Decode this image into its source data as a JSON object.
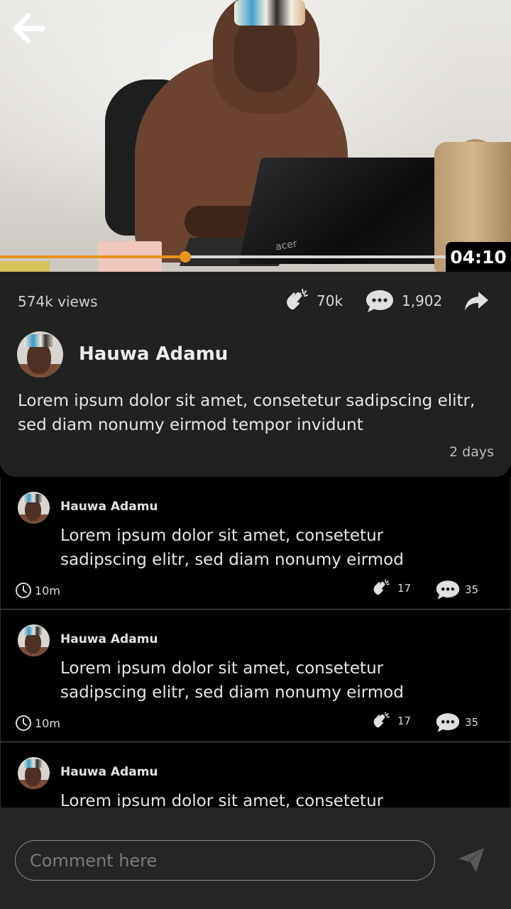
{
  "video": {
    "duration": "04:10",
    "progress": 0.41,
    "laptop_brand": "acer"
  },
  "info": {
    "views": "574k views",
    "claps": "70k",
    "comments_count": "1,902",
    "author_name": "Hauwa Adamu",
    "description": "Lorem ipsum dolor sit amet, consetetur sadipscing elitr, sed diam nonumy eirmod tempor invidunt",
    "posted_ago": "2 days"
  },
  "comments": [
    {
      "author": "Hauwa Adamu",
      "text": "Lorem ipsum dolor sit amet, consetetur sadipscing elitr, sed diam nonumy eirmod",
      "time": "10m",
      "likes": "17",
      "replies": "35"
    },
    {
      "author": "Hauwa Adamu",
      "text": "Lorem ipsum dolor sit amet, consetetur sadipscing elitr, sed diam nonumy eirmod",
      "time": "10m",
      "likes": "17",
      "replies": "35"
    },
    {
      "author": "Hauwa Adamu",
      "text": "Lorem ipsum dolor sit amet, consetetur",
      "time": "",
      "likes": "",
      "replies": ""
    }
  ],
  "composer": {
    "placeholder": "Comment here"
  },
  "colors": {
    "accent": "#e8931a",
    "card_bg": "#212122",
    "page_bg": "#000000",
    "bottom_bar": "#252525"
  },
  "icons": {
    "back": "arrow-left-icon",
    "clap": "clap-icon",
    "comment": "speech-bubble-icon",
    "share": "share-arrow-icon",
    "clock": "clock-icon",
    "send": "paper-plane-icon"
  }
}
